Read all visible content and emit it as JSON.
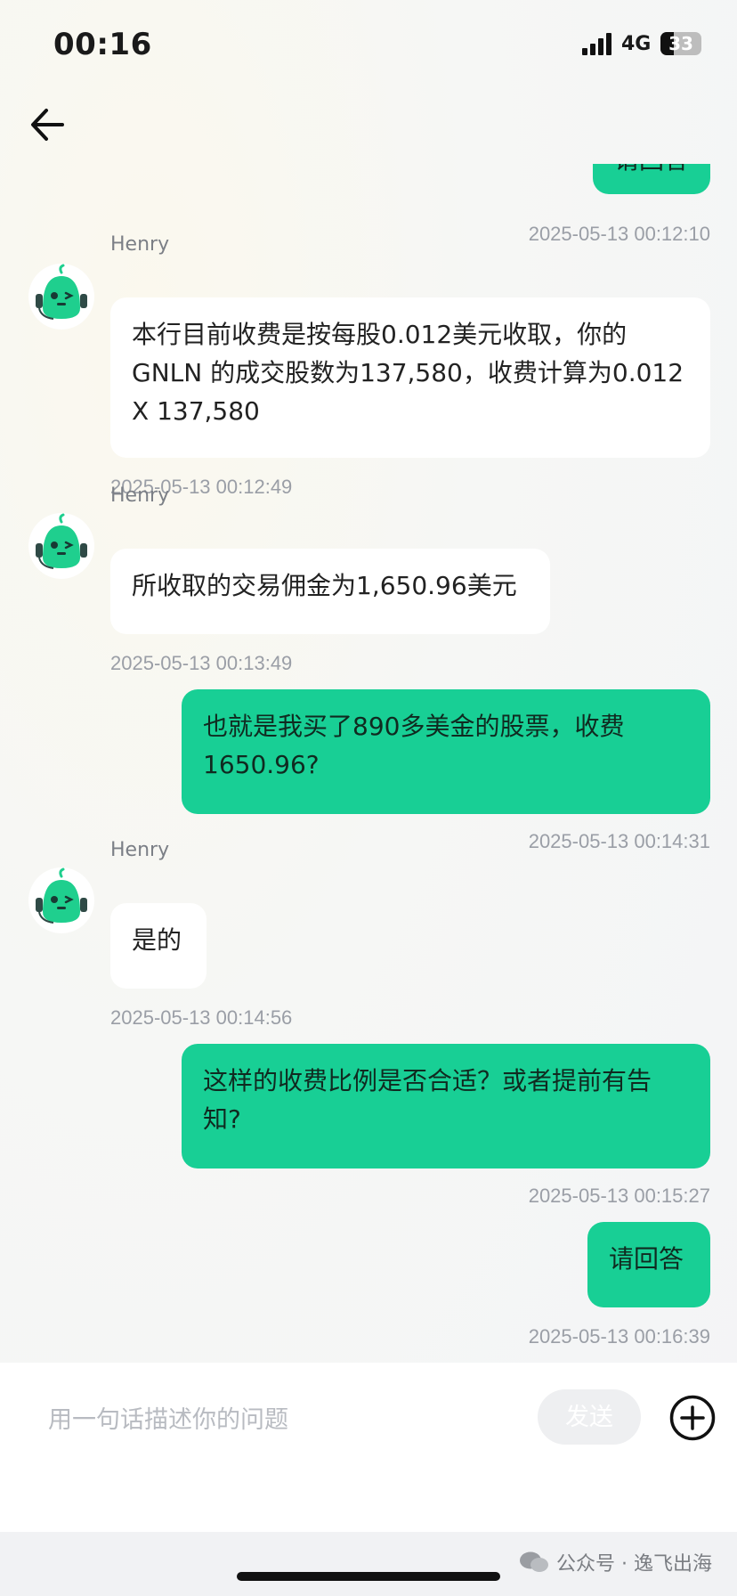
{
  "status_bar": {
    "time": "00:16",
    "network": "4G",
    "battery": "33"
  },
  "messages": [
    {
      "side": "out",
      "text": "请回答",
      "time": "2025-05-13 00:12:10"
    },
    {
      "side": "in",
      "sender": "Henry",
      "text": "本行目前收费是按每股0.012美元收取，你的GNLN 的成交股数为137,580，收费计算为0.012 X 137,580",
      "time": "2025-05-13 00:12:49"
    },
    {
      "side": "in",
      "sender": "Henry",
      "text": "所收取的交易佣金为1,650.96美元",
      "time": "2025-05-13 00:13:49"
    },
    {
      "side": "out",
      "text": "也就是我买了890多美金的股票，收费1650.96?",
      "time": "2025-05-13 00:14:31"
    },
    {
      "side": "in",
      "sender": "Henry",
      "text": "是的",
      "time": "2025-05-13 00:14:56"
    },
    {
      "side": "out",
      "text": "这样的收费比例是否合适？或者提前有告知?",
      "time": "2025-05-13 00:15:27"
    },
    {
      "side": "out",
      "text": "请回答",
      "time": "2025-05-13 00:16:39"
    }
  ],
  "input": {
    "placeholder": "用一句话描述你的问题",
    "send_label": "发送"
  },
  "watermark": "公众号 · 逸飞出海",
  "colors": {
    "outgoing_bubble": "#18cf95",
    "incoming_bubble": "#ffffff",
    "avatar_green": "#1fcf8e"
  },
  "icons": {
    "back": "arrow-left-icon",
    "plus": "plus-circle-icon",
    "avatar": "robot-avatar-icon",
    "watermark": "wechat-icon"
  }
}
